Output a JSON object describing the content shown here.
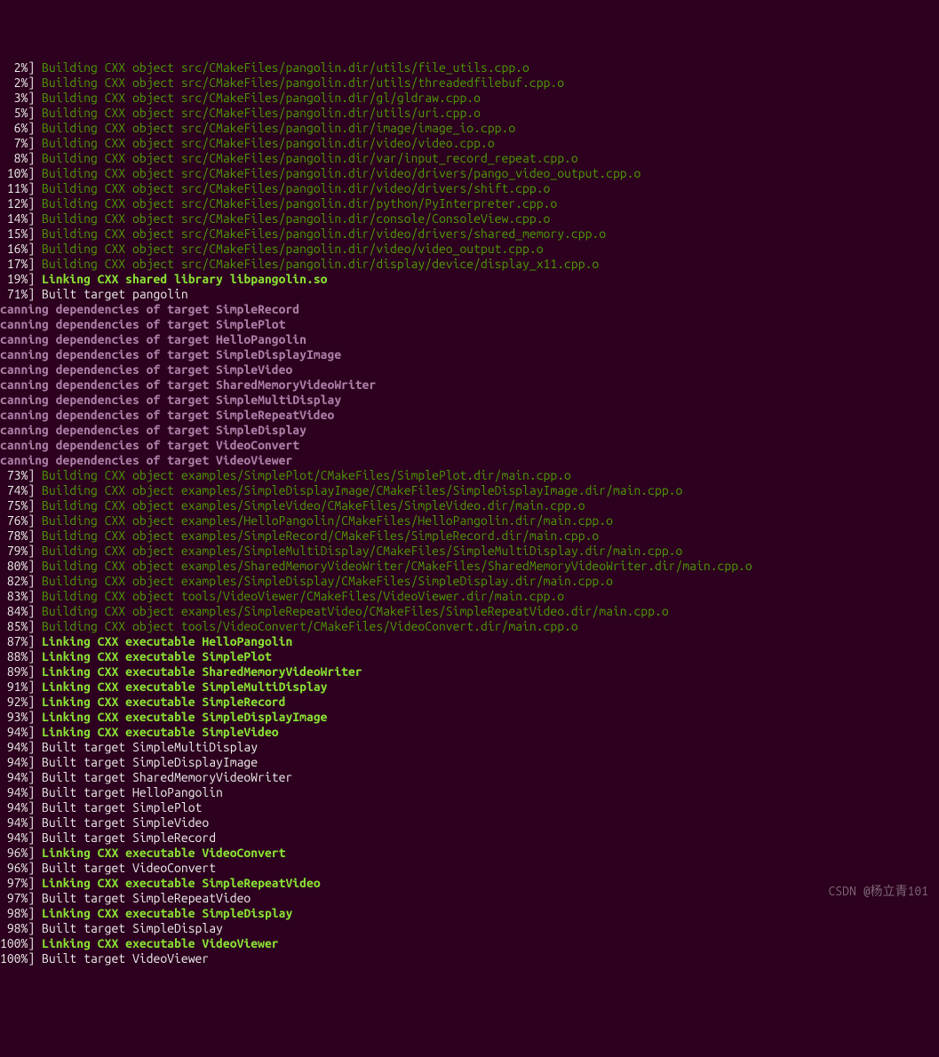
{
  "watermark": "CSDN @杨立青101",
  "lines": [
    {
      "type": "build",
      "pct": "  2%",
      "text": "Building CXX object src/CMakeFiles/pangolin.dir/utils/file_utils.cpp.o"
    },
    {
      "type": "build",
      "pct": "  2%",
      "text": "Building CXX object src/CMakeFiles/pangolin.dir/utils/threadedfilebuf.cpp.o"
    },
    {
      "type": "build",
      "pct": "  3%",
      "text": "Building CXX object src/CMakeFiles/pangolin.dir/gl/gldraw.cpp.o"
    },
    {
      "type": "build",
      "pct": "  5%",
      "text": "Building CXX object src/CMakeFiles/pangolin.dir/utils/uri.cpp.o"
    },
    {
      "type": "build",
      "pct": "  6%",
      "text": "Building CXX object src/CMakeFiles/pangolin.dir/image/image_io.cpp.o"
    },
    {
      "type": "build",
      "pct": "  7%",
      "text": "Building CXX object src/CMakeFiles/pangolin.dir/video/video.cpp.o"
    },
    {
      "type": "build",
      "pct": "  8%",
      "text": "Building CXX object src/CMakeFiles/pangolin.dir/var/input_record_repeat.cpp.o"
    },
    {
      "type": "build",
      "pct": " 10%",
      "text": "Building CXX object src/CMakeFiles/pangolin.dir/video/drivers/pango_video_output.cpp.o"
    },
    {
      "type": "build",
      "pct": " 11%",
      "text": "Building CXX object src/CMakeFiles/pangolin.dir/video/drivers/shift.cpp.o"
    },
    {
      "type": "build",
      "pct": " 12%",
      "text": "Building CXX object src/CMakeFiles/pangolin.dir/python/PyInterpreter.cpp.o"
    },
    {
      "type": "build",
      "pct": " 14%",
      "text": "Building CXX object src/CMakeFiles/pangolin.dir/console/ConsoleView.cpp.o"
    },
    {
      "type": "build",
      "pct": " 15%",
      "text": "Building CXX object src/CMakeFiles/pangolin.dir/video/drivers/shared_memory.cpp.o"
    },
    {
      "type": "build",
      "pct": " 16%",
      "text": "Building CXX object src/CMakeFiles/pangolin.dir/video/video_output.cpp.o"
    },
    {
      "type": "build",
      "pct": " 17%",
      "text": "Building CXX object src/CMakeFiles/pangolin.dir/display/device/display_x11.cpp.o"
    },
    {
      "type": "link",
      "pct": " 19%",
      "text": "Linking CXX shared library libpangolin.so"
    },
    {
      "type": "built",
      "pct": " 71%",
      "text": "Built target pangolin"
    },
    {
      "type": "scan",
      "text": "canning dependencies of target SimpleRecord"
    },
    {
      "type": "scan",
      "text": "canning dependencies of target SimplePlot"
    },
    {
      "type": "scan",
      "text": "canning dependencies of target HelloPangolin"
    },
    {
      "type": "scan",
      "text": "canning dependencies of target SimpleDisplayImage"
    },
    {
      "type": "scan",
      "text": "canning dependencies of target SimpleVideo"
    },
    {
      "type": "scan",
      "text": "canning dependencies of target SharedMemoryVideoWriter"
    },
    {
      "type": "scan",
      "text": "canning dependencies of target SimpleMultiDisplay"
    },
    {
      "type": "scan",
      "text": "canning dependencies of target SimpleRepeatVideo"
    },
    {
      "type": "scan",
      "text": "canning dependencies of target SimpleDisplay"
    },
    {
      "type": "scan",
      "text": "canning dependencies of target VideoConvert"
    },
    {
      "type": "scan",
      "text": "canning dependencies of target VideoViewer"
    },
    {
      "type": "build",
      "pct": " 73%",
      "text": "Building CXX object examples/SimplePlot/CMakeFiles/SimplePlot.dir/main.cpp.o"
    },
    {
      "type": "build",
      "pct": " 74%",
      "text": "Building CXX object examples/SimpleDisplayImage/CMakeFiles/SimpleDisplayImage.dir/main.cpp.o"
    },
    {
      "type": "build",
      "pct": " 75%",
      "text": "Building CXX object examples/SimpleVideo/CMakeFiles/SimpleVideo.dir/main.cpp.o"
    },
    {
      "type": "build",
      "pct": " 76%",
      "text": "Building CXX object examples/HelloPangolin/CMakeFiles/HelloPangolin.dir/main.cpp.o"
    },
    {
      "type": "build",
      "pct": " 78%",
      "text": "Building CXX object examples/SimpleRecord/CMakeFiles/SimpleRecord.dir/main.cpp.o"
    },
    {
      "type": "build",
      "pct": " 79%",
      "text": "Building CXX object examples/SimpleMultiDisplay/CMakeFiles/SimpleMultiDisplay.dir/main.cpp.o"
    },
    {
      "type": "build",
      "pct": " 80%",
      "text": "Building CXX object examples/SharedMemoryVideoWriter/CMakeFiles/SharedMemoryVideoWriter.dir/main.cpp.o"
    },
    {
      "type": "build",
      "pct": " 82%",
      "text": "Building CXX object examples/SimpleDisplay/CMakeFiles/SimpleDisplay.dir/main.cpp.o"
    },
    {
      "type": "build",
      "pct": " 83%",
      "text": "Building CXX object tools/VideoViewer/CMakeFiles/VideoViewer.dir/main.cpp.o"
    },
    {
      "type": "build",
      "pct": " 84%",
      "text": "Building CXX object examples/SimpleRepeatVideo/CMakeFiles/SimpleRepeatVideo.dir/main.cpp.o"
    },
    {
      "type": "build",
      "pct": " 85%",
      "text": "Building CXX object tools/VideoConvert/CMakeFiles/VideoConvert.dir/main.cpp.o"
    },
    {
      "type": "link",
      "pct": " 87%",
      "text": "Linking CXX executable HelloPangolin"
    },
    {
      "type": "link",
      "pct": " 88%",
      "text": "Linking CXX executable SimplePlot"
    },
    {
      "type": "link",
      "pct": " 89%",
      "text": "Linking CXX executable SharedMemoryVideoWriter"
    },
    {
      "type": "link",
      "pct": " 91%",
      "text": "Linking CXX executable SimpleMultiDisplay"
    },
    {
      "type": "link",
      "pct": " 92%",
      "text": "Linking CXX executable SimpleRecord"
    },
    {
      "type": "link",
      "pct": " 93%",
      "text": "Linking CXX executable SimpleDisplayImage"
    },
    {
      "type": "link",
      "pct": " 94%",
      "text": "Linking CXX executable SimpleVideo"
    },
    {
      "type": "built",
      "pct": " 94%",
      "text": "Built target SimpleMultiDisplay"
    },
    {
      "type": "built",
      "pct": " 94%",
      "text": "Built target SimpleDisplayImage"
    },
    {
      "type": "built",
      "pct": " 94%",
      "text": "Built target SharedMemoryVideoWriter"
    },
    {
      "type": "built",
      "pct": " 94%",
      "text": "Built target HelloPangolin"
    },
    {
      "type": "built",
      "pct": " 94%",
      "text": "Built target SimplePlot"
    },
    {
      "type": "built",
      "pct": " 94%",
      "text": "Built target SimpleVideo"
    },
    {
      "type": "built",
      "pct": " 94%",
      "text": "Built target SimpleRecord"
    },
    {
      "type": "link",
      "pct": " 96%",
      "text": "Linking CXX executable VideoConvert"
    },
    {
      "type": "built",
      "pct": " 96%",
      "text": "Built target VideoConvert"
    },
    {
      "type": "link",
      "pct": " 97%",
      "text": "Linking CXX executable SimpleRepeatVideo"
    },
    {
      "type": "built",
      "pct": " 97%",
      "text": "Built target SimpleRepeatVideo"
    },
    {
      "type": "link",
      "pct": " 98%",
      "text": "Linking CXX executable SimpleDisplay"
    },
    {
      "type": "built",
      "pct": " 98%",
      "text": "Built target SimpleDisplay"
    },
    {
      "type": "link",
      "pct": "100%",
      "text": "Linking CXX executable VideoViewer"
    },
    {
      "type": "built",
      "pct": "100%",
      "text": "Built target VideoViewer"
    }
  ]
}
